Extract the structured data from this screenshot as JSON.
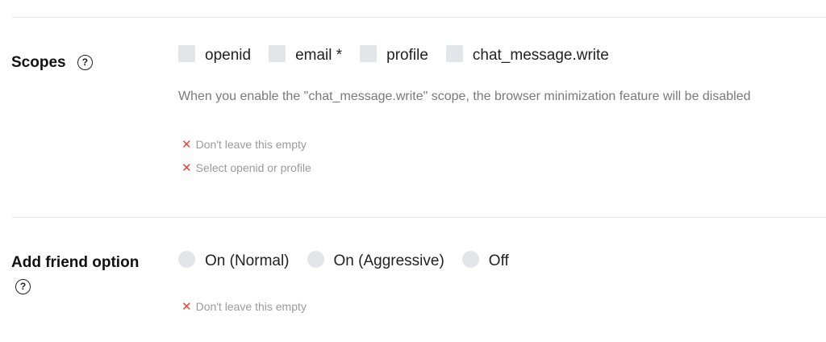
{
  "scopes": {
    "label": "Scopes",
    "options": [
      {
        "label": "openid",
        "checked": false
      },
      {
        "label": "email *",
        "checked": false
      },
      {
        "label": "profile",
        "checked": false
      },
      {
        "label": "chat_message.write",
        "checked": false
      }
    ],
    "note": "When you enable the \"chat_message.write\" scope, the browser minimization feature will be disabled",
    "errors": [
      "Don't leave this empty",
      "Select openid or profile"
    ]
  },
  "add_friend": {
    "label": "Add friend option",
    "options": [
      {
        "label": "On (Normal)",
        "selected": false
      },
      {
        "label": "On (Aggressive)",
        "selected": false
      },
      {
        "label": "Off",
        "selected": false
      }
    ],
    "errors": [
      "Don't leave this empty"
    ]
  },
  "icons": {
    "help": "question-circle-icon",
    "error": "x-icon"
  },
  "colors": {
    "error_icon": "#e0443a",
    "control_bg": "#e2e6ea"
  }
}
